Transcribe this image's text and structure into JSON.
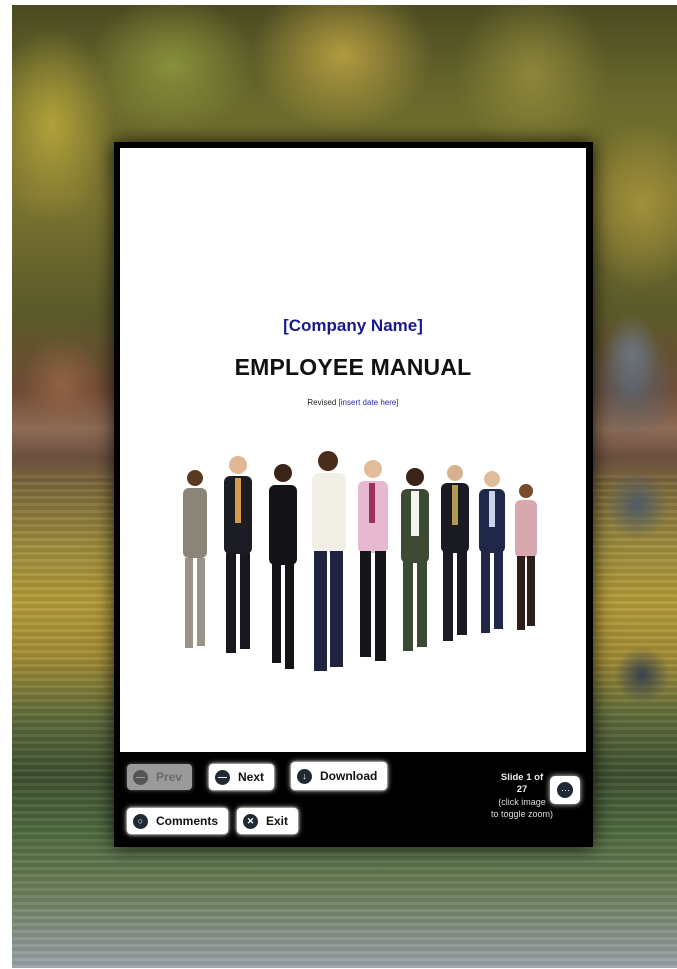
{
  "document": {
    "company_name": "[Company Name]",
    "title": "EMPLOYEE MANUAL",
    "revised_label": "Revised",
    "revised_date": "[insert date here]"
  },
  "controls": {
    "prev_label": "Prev",
    "next_label": "Next",
    "download_label": "Download",
    "comments_label": "Comments",
    "exit_label": "Exit"
  },
  "slide_info": {
    "line1": "Slide 1 of",
    "line2": "27",
    "line3": "(click image",
    "line4": "to toggle zoom)"
  },
  "colors": {
    "viewer_frame": "#000000",
    "company_name": "#1a1a8c",
    "button_icon": "#1f2a36"
  },
  "icons": {
    "prev": "minus-circle-icon",
    "next": "minus-circle-icon",
    "download": "download-circle-icon",
    "comments": "speech-bubble-icon",
    "exit": "close-circle-icon",
    "thumbnails": "grid-dots-icon"
  }
}
